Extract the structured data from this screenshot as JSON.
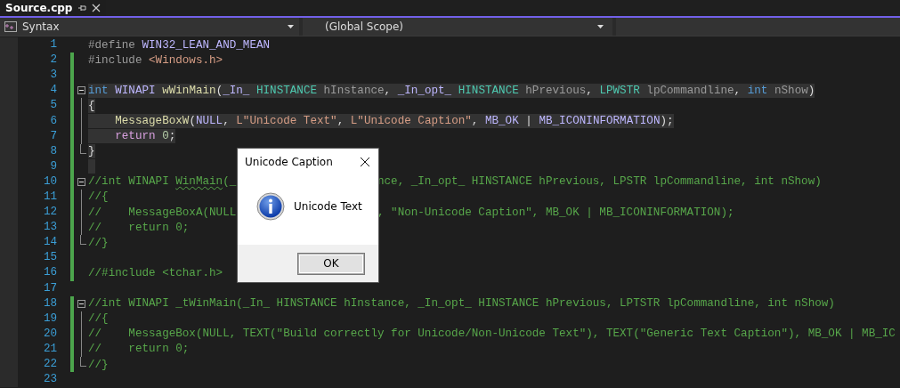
{
  "tab": {
    "title": "Source.cpp",
    "selected": true
  },
  "nav": {
    "project": "Syntax",
    "scope": "(Global Scope)"
  },
  "lines": [
    {
      "number": "1",
      "changed": false,
      "kind": "plain",
      "highlighted": false,
      "segments": [
        [
          {
            "t": "#define",
            "kind": "pre"
          },
          {
            "t": " WIN32_LEAN_AND_MEAN",
            "kind": "macro"
          }
        ]
      ]
    },
    {
      "number": "2",
      "changed": true,
      "kind": "plain",
      "highlighted": false,
      "segments": [
        [
          {
            "t": "#include",
            "kind": "pre"
          },
          {
            "t": " <Windows.h>",
            "kind": "string"
          }
        ]
      ]
    },
    {
      "number": "3",
      "changed": true,
      "kind": "plain",
      "highlighted": false
    },
    {
      "number": "4",
      "changed": true,
      "kind": "fold-start",
      "highlighted": true,
      "segments": [
        [
          {
            "t": "int",
            "kind": "kw"
          },
          {
            "t": " WINAPI",
            "kind": "macro"
          },
          {
            "t": " wWinMain",
            "kind": "fn"
          },
          {
            "t": "(",
            "kind": "plain"
          },
          {
            "t": "_In_",
            "kind": "macro"
          },
          {
            "t": " HINSTANCE",
            "kind": "type"
          },
          {
            "t": " hInstance",
            "kind": "param"
          },
          {
            "t": ",",
            "kind": "plain"
          },
          {
            "t": " _In_opt_",
            "kind": "macro"
          },
          {
            "t": " HINSTANCE",
            "kind": "type"
          },
          {
            "t": " hPrevious",
            "kind": "param"
          },
          {
            "t": ",",
            "kind": "plain"
          },
          {
            "t": " LPWSTR",
            "kind": "type"
          },
          {
            "t": " lpCommandline",
            "kind": "param"
          },
          {
            "t": ",",
            "kind": "plain"
          },
          {
            "t": " int",
            "kind": "kw"
          },
          {
            "t": " nShow",
            "kind": "param"
          },
          {
            "t": ")",
            "kind": "plain"
          }
        ]
      ]
    },
    {
      "number": "5",
      "changed": true,
      "kind": "fold-inside",
      "highlighted": true,
      "segments": [
        [
          {
            "t": "{",
            "kind": "plain"
          }
        ]
      ]
    },
    {
      "number": "6",
      "changed": true,
      "kind": "fold-inside",
      "highlighted": true,
      "segments": [
        [
          {
            "t": "    MessageBoxW",
            "kind": "fn"
          },
          {
            "t": "(",
            "kind": "plain"
          },
          {
            "t": "NULL",
            "kind": "macro"
          },
          {
            "t": ",",
            "kind": "plain"
          },
          {
            "t": " L\"Unicode Text\"",
            "kind": "string"
          },
          {
            "t": ",",
            "kind": "plain"
          },
          {
            "t": " L\"Unicode Caption\"",
            "kind": "string"
          },
          {
            "t": ",",
            "kind": "plain"
          },
          {
            "t": " MB_OK",
            "kind": "macro"
          },
          {
            "t": " |",
            "kind": "plain"
          },
          {
            "t": " MB_ICONINFORMATION",
            "kind": "macro"
          },
          {
            "t": ");",
            "kind": "plain"
          }
        ]
      ]
    },
    {
      "number": "7",
      "changed": true,
      "kind": "fold-inside",
      "highlighted": true,
      "segments": [
        [
          {
            "t": "    return",
            "kind": "ctl"
          },
          {
            "t": " 0",
            "kind": "num"
          },
          {
            "t": ";",
            "kind": "plain"
          }
        ]
      ]
    },
    {
      "number": "8",
      "changed": true,
      "kind": "fold-end",
      "highlighted": true,
      "segments": [
        [
          {
            "t": "}",
            "kind": "plain"
          }
        ]
      ]
    },
    {
      "number": "9",
      "changed": true,
      "kind": "plain",
      "highlighted": true
    },
    {
      "number": "10",
      "changed": true,
      "kind": "fold-start",
      "highlighted": false,
      "segments": [
        [
          {
            "t": "//int WINAPI ",
            "kind": "cm"
          },
          {
            "t": "WinMain",
            "kind": "cm",
            "squiggle": true
          },
          {
            "t": "(_",
            "kind": "cm"
          }
        ],
        [
          {
            "t": "nce, _In_opt_ HINSTANCE hPrevious, LPSTR lpCommandline, int nShow)",
            "kind": "cm"
          }
        ]
      ]
    },
    {
      "number": "11",
      "changed": true,
      "kind": "fold-inside",
      "highlighted": false,
      "segments": [
        [
          {
            "t": "//{",
            "kind": "cm"
          }
        ]
      ]
    },
    {
      "number": "12",
      "changed": true,
      "kind": "fold-inside",
      "highlighted": false,
      "segments": [
        [
          {
            "t": "//    MessageBoxA(NULL",
            "kind": "cm"
          }
        ],
        [
          {
            "t": ", \"Non-Unicode Caption\", MB_OK | MB_ICONINFORMATION);",
            "kind": "cm"
          }
        ]
      ]
    },
    {
      "number": "13",
      "changed": true,
      "kind": "fold-inside",
      "highlighted": false,
      "segments": [
        [
          {
            "t": "//    return 0;",
            "kind": "cm"
          }
        ]
      ]
    },
    {
      "number": "14",
      "changed": true,
      "kind": "fold-end",
      "highlighted": false,
      "segments": [
        [
          {
            "t": "//}",
            "kind": "cm"
          }
        ]
      ]
    },
    {
      "number": "15",
      "changed": true,
      "kind": "plain",
      "highlighted": false
    },
    {
      "number": "16",
      "changed": true,
      "kind": "plain",
      "highlighted": false,
      "segments": [
        [
          {
            "t": "//#include <tchar.h>",
            "kind": "cm"
          }
        ]
      ]
    },
    {
      "number": "17",
      "changed": false,
      "kind": "plain",
      "highlighted": false
    },
    {
      "number": "18",
      "changed": true,
      "kind": "fold-start",
      "highlighted": false,
      "segments": [
        [
          {
            "t": "//int WINAPI _tWinMain(_In_ HINSTANCE hInstance, _In_opt_ HINSTANCE hPrevious, LPTSTR lpCommandline, int nShow)",
            "kind": "cm"
          }
        ]
      ]
    },
    {
      "number": "19",
      "changed": true,
      "kind": "fold-inside",
      "highlighted": false,
      "segments": [
        [
          {
            "t": "//{",
            "kind": "cm"
          }
        ]
      ]
    },
    {
      "number": "20",
      "changed": true,
      "kind": "fold-inside",
      "highlighted": false,
      "segments": [
        [
          {
            "t": "//    MessageBox(NULL, TEXT(\"Build correctly for Unicode/Non-Unicode Text\"), TEXT(\"Generic Text Caption\"), MB_OK | MB_IC",
            "kind": "cm"
          }
        ]
      ]
    },
    {
      "number": "21",
      "changed": true,
      "kind": "fold-inside",
      "highlighted": false,
      "segments": [
        [
          {
            "t": "//    return 0;",
            "kind": "cm"
          }
        ]
      ]
    },
    {
      "number": "22",
      "changed": true,
      "kind": "fold-end",
      "highlighted": false,
      "segments": [
        [
          {
            "t": "//}",
            "kind": "cm"
          }
        ]
      ]
    },
    {
      "number": "23",
      "changed": false,
      "kind": "plain",
      "highlighted": false
    }
  ],
  "dialog": {
    "title": "Unicode Caption",
    "message": "Unicode Text",
    "button": "OK"
  }
}
